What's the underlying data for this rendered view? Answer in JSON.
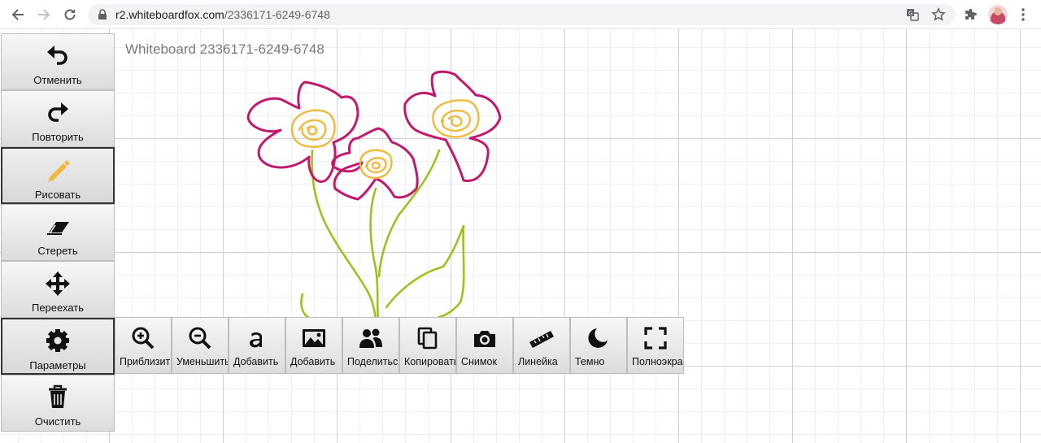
{
  "browser": {
    "url_host": "r2.whiteboardfox.com",
    "url_path": "/2336171-6249-6748",
    "icons": [
      "back-icon",
      "forward-icon",
      "reload-icon",
      "lock-icon",
      "translate-icon",
      "star-icon",
      "extensions-icon",
      "profile-avatar",
      "menu-icon"
    ]
  },
  "board": {
    "title": "Whiteboard 2336171-6249-6748"
  },
  "toolbar": {
    "undo": "Отменить",
    "redo": "Повторить",
    "draw": "Рисовать",
    "erase": "Стереть",
    "move": "Переехать",
    "settings": "Параметры",
    "clear": "Очистить"
  },
  "options": {
    "zoom_in": "Приблизить",
    "zoom_out": "Уменьшить",
    "add_text": "Добавить",
    "add_image": "Добавить",
    "share": "Поделиться",
    "copy": "Копировать",
    "snapshot": "Снимок",
    "ruler": "Линейка",
    "dark": "Темно",
    "fullscreen": "Полноэкран"
  },
  "colors": {
    "petal": "#c2186e",
    "center": "#f0b93a",
    "stem": "#9cc21c",
    "pencil": "#f0b93a"
  }
}
